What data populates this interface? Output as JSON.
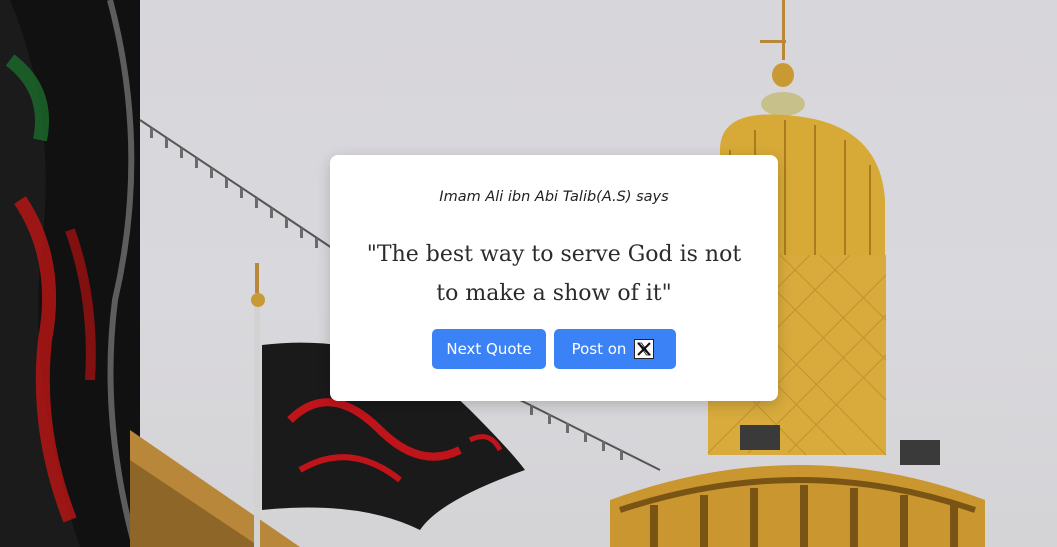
{
  "quote_card": {
    "author_line": "Imam Ali ibn Abi Talib(A.S) says",
    "quote_text": "\"The best way to serve God is not to make a show of it\"",
    "next_button_label": "Next Quote",
    "post_button_label": "Post on"
  },
  "icons": {
    "post_button_icon": "x-logo-icon"
  },
  "colors": {
    "accent": "#3b82f6",
    "card_background": "#ffffff",
    "page_background": "#d8d7db",
    "dome_gold": "#d7a936"
  }
}
